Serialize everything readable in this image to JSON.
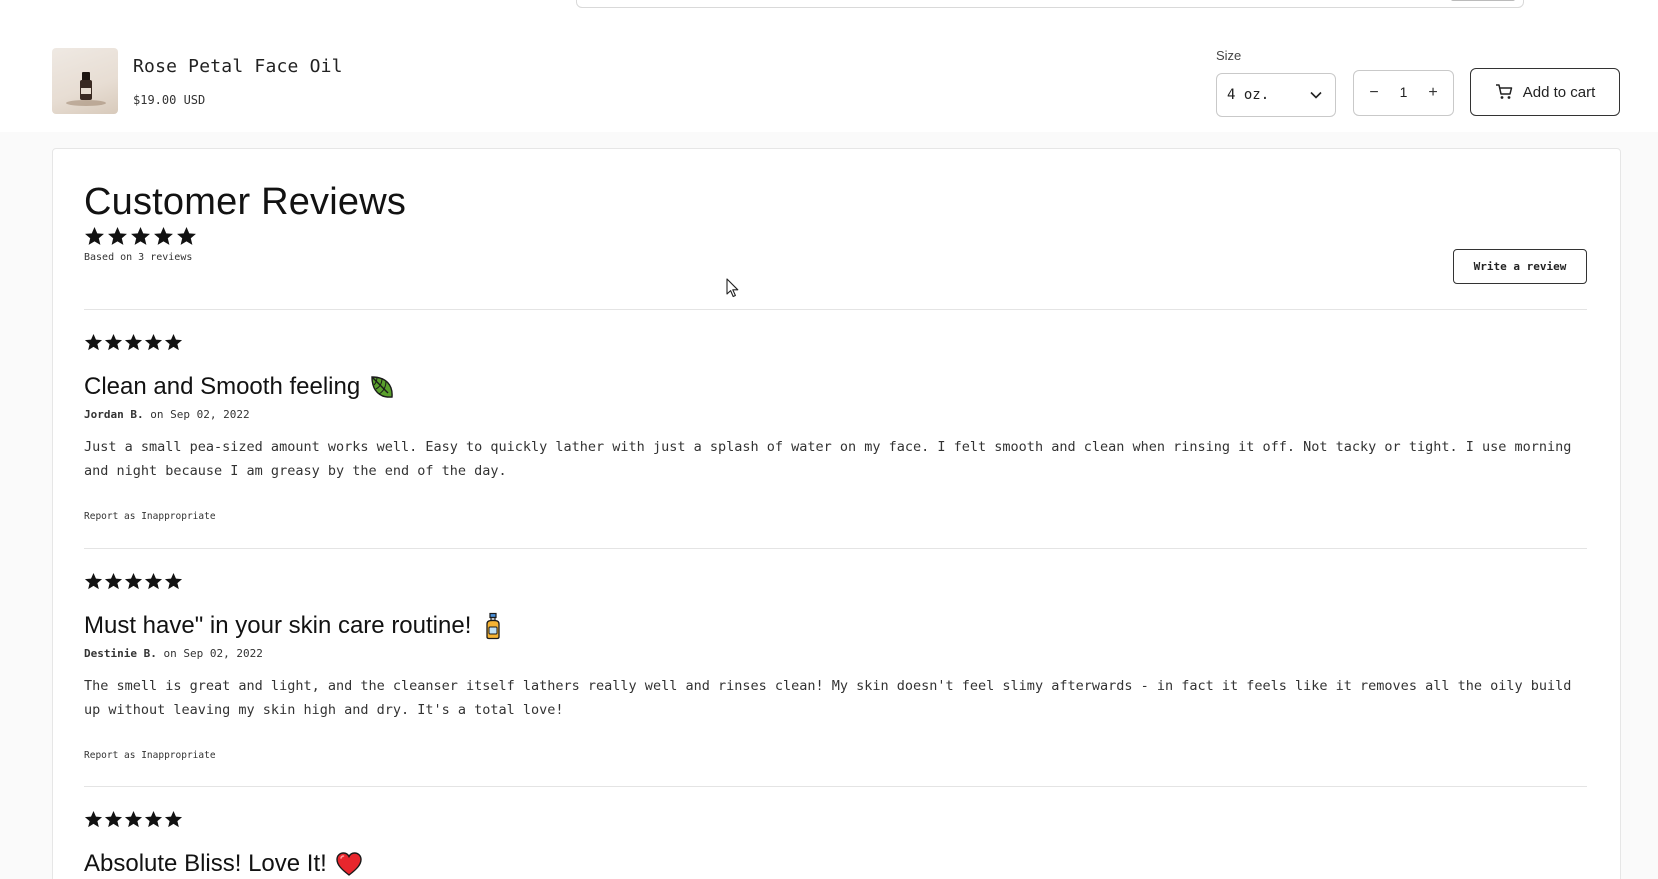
{
  "product": {
    "name": "Rose Petal Face Oil",
    "price": "$19.00 USD",
    "size_label": "Size",
    "size_value": "4 oz.",
    "quantity": "1",
    "quantity_minus": "−",
    "quantity_plus": "+",
    "add_to_cart": "Add to cart"
  },
  "reviews": {
    "title": "Customer Reviews",
    "summary_rating": 5,
    "based_on": "Based on 3 reviews",
    "write_review": "Write a review",
    "items": [
      {
        "rating": 5,
        "title": "Clean and Smooth feeling",
        "emoji": "leaf-icon",
        "author": "Jordan B.",
        "date": "on Sep 02, 2022",
        "body": "Just a small pea-sized amount works well. Easy to quickly lather with just a splash of water on my face. I felt smooth and clean when rinsing it off. Not tacky or tight. I use morning and night because I am greasy by the end of the day.",
        "report": "Report as Inappropriate"
      },
      {
        "rating": 5,
        "title": "Must have\" in your skin care routine!",
        "emoji": "lotion-bottle-icon",
        "author": "Destinie B.",
        "date": "on Sep 02, 2022",
        "body": "The smell is great and light, and the cleanser itself lathers really well and rinses clean! My skin doesn't feel slimy afterwards - in fact it feels like it removes all the oily build up without leaving my skin high and dry. It's a total love!",
        "report": "Report as Inappropriate"
      },
      {
        "rating": 5,
        "title": "Absolute Bliss! Love It!",
        "emoji": "red-heart-icon"
      }
    ]
  },
  "colors": {
    "text": "#121212",
    "star": "#121212",
    "border": "#e4e4e4"
  }
}
